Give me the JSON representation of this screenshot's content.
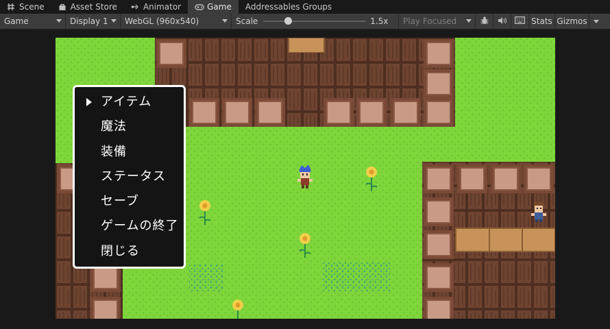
{
  "tabs": [
    {
      "label": "Scene",
      "icon": "grid-icon",
      "active": false
    },
    {
      "label": "Asset Store",
      "icon": "bag-icon",
      "active": false
    },
    {
      "label": "Animator",
      "icon": "animator-icon",
      "active": false
    },
    {
      "label": "Game",
      "icon": "gamepad-icon",
      "active": true
    },
    {
      "label": "Addressables Groups",
      "icon": "",
      "active": false
    }
  ],
  "toolbar": {
    "display_mode": "Game",
    "display": "Display 1",
    "resolution": "WebGL (960x540)",
    "scale_label": "Scale",
    "scale_value": "1.5x",
    "scale_level": 0.12,
    "play_focused": "Play Focused",
    "stats": "Stats",
    "gizmos": "Gizmos"
  },
  "menu": {
    "items": [
      "アイテム",
      "魔法",
      "装備",
      "ステータス",
      "セーブ",
      "ゲームの終了",
      "閉じる"
    ],
    "selected_index": 0
  },
  "colors": {
    "grass": "#7fd63b",
    "brick": "#6e4431",
    "brick_dark": "#4e2e20",
    "tile_face": "#c99a85",
    "counter": "#c8935a",
    "menu_bg": "#141414",
    "menu_border": "#ffffff"
  }
}
